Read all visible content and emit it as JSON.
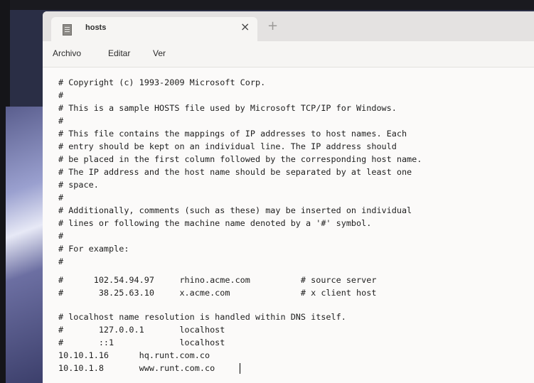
{
  "tab": {
    "title": "hosts",
    "icon": "document-icon",
    "close": "×",
    "new_tab": "+"
  },
  "menu": {
    "file": "Archivo",
    "edit": "Editar",
    "view": "Ver"
  },
  "editor": {
    "lines": [
      "# Copyright (c) 1993-2009 Microsoft Corp.",
      "#",
      "# This is a sample HOSTS file used by Microsoft TCP/IP for Windows.",
      "#",
      "# This file contains the mappings of IP addresses to host names. Each",
      "# entry should be kept on an individual line. The IP address should",
      "# be placed in the first column followed by the corresponding host name.",
      "# The IP address and the host name should be separated by at least one",
      "# space.",
      "#",
      "# Additionally, comments (such as these) may be inserted on individual",
      "# lines or following the machine name denoted by a '#' symbol.",
      "#",
      "# For example:",
      "#",
      "#      102.54.94.97     rhino.acme.com          # source server",
      "#       38.25.63.10     x.acme.com              # x client host",
      "",
      "# localhost name resolution is handled within DNS itself.",
      "#       127.0.0.1       localhost",
      "#       ::1             localhost",
      "10.10.1.16      hq.runt.com.co",
      "10.10.1.8       www.runt.com.co"
    ]
  }
}
